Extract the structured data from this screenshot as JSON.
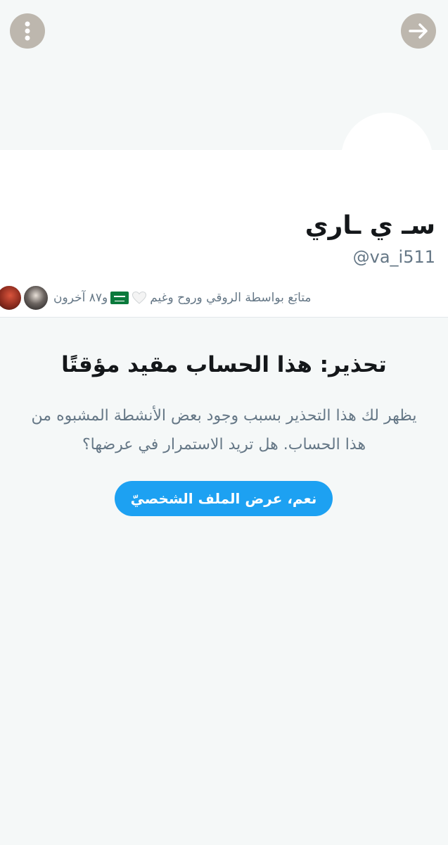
{
  "header": {
    "more_icon": "more-vertical-icon",
    "back_icon": "arrow-right-icon",
    "button_color": "#bdb7ae"
  },
  "profile": {
    "display_name": "سـ ي ـاري",
    "handle": "@va_i511",
    "followers_text_before": "متابَع بواسطة الروقي وروح وغيم",
    "followers_text_after": "و٨٧ آخرون"
  },
  "warning": {
    "title": "تحذير: هذا الحساب مقيد مؤقتًا",
    "body": "يظهر لك هذا التحذير بسبب وجود بعض الأنشطة المشبوه من هذا الحساب. هل تريد الاستمرار في عرضها؟",
    "button_label": "نعم، عرض الملف الشخصيّ",
    "accent_color": "#1da1f2"
  }
}
